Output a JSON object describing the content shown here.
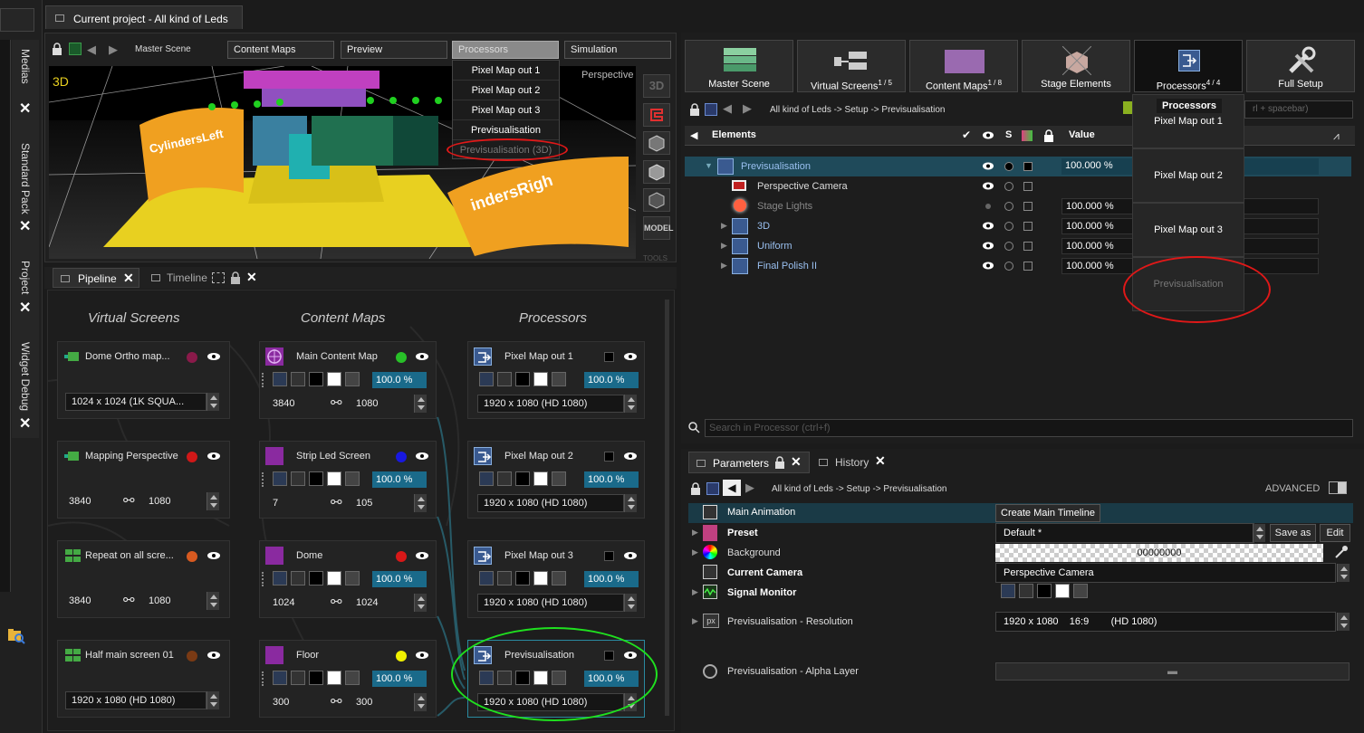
{
  "window": {
    "tab_title": "Current project - All kind of Leds"
  },
  "left_dock": {
    "tabs": [
      "Medias",
      "Standard Pack",
      "Project",
      "Widget Debug"
    ]
  },
  "viewport": {
    "breadcrumb_scene": "Master Scene",
    "crumbs": [
      "Content Maps",
      "Preview",
      "Processors",
      "Simulation"
    ],
    "processors_menu": [
      "Pixel Map out 1",
      "Pixel Map out 2",
      "Pixel Map out 3",
      "Previsualisation",
      "Previsualisation (3D)"
    ],
    "mode_label": "3D",
    "camera_label": "Perspective",
    "tools": [
      "3D",
      "magnet",
      "cube",
      "sphere",
      "cube2",
      "MODEL"
    ],
    "tools_footer": "TOOLS",
    "scene_text": [
      "CylindersLeft",
      "indersRigh"
    ]
  },
  "pipeline": {
    "tabs": [
      "Pipeline",
      "Timeline"
    ],
    "columns": [
      "Virtual Screens",
      "Content Maps",
      "Processors"
    ],
    "virtual_screens": [
      {
        "name": "Dome Ortho map...",
        "color": "#8a1a4a",
        "value": "1024 x 1024   (1K SQUA..."
      },
      {
        "name": "Mapping Perspective",
        "color": "#d01818",
        "a": "3840",
        "b": "1080"
      },
      {
        "name": "Repeat on all scre...",
        "color": "#d85a20",
        "a": "3840",
        "b": "1080"
      },
      {
        "name": "Half main screen 01",
        "color": "#7a3a14",
        "value": "1920 x 1080    (HD 1080)"
      }
    ],
    "content_maps": [
      {
        "name": "Main Content Map",
        "color": "#28c028",
        "pct": "100.0 %",
        "a": "3840",
        "b": "1080"
      },
      {
        "name": "Strip Led Screen",
        "color": "#1818e0",
        "pct": "100.0 %",
        "a": "7",
        "b": "105"
      },
      {
        "name": "Dome",
        "color": "#d81818",
        "pct": "100.0 %",
        "a": "1024",
        "b": "1024"
      },
      {
        "name": "Floor",
        "color": "#f0f000",
        "pct": "100.0 %",
        "a": "300",
        "b": "300"
      }
    ],
    "processors": [
      {
        "name": "Pixel Map out 1",
        "pct": "100.0 %",
        "value": "1920 x 1080    (HD 1080)"
      },
      {
        "name": "Pixel Map out 2",
        "pct": "100.0 %",
        "value": "1920 x 1080    (HD 1080)"
      },
      {
        "name": "Pixel Map out 3",
        "pct": "100.0 %",
        "value": "1920 x 1080    (HD 1080)"
      },
      {
        "name": "Previsualisation",
        "pct": "100.0 %",
        "value": "1920 x 1080    (HD 1080)"
      }
    ]
  },
  "top_tabs": [
    {
      "label": "Master Scene",
      "count": ""
    },
    {
      "label": "Virtual Screens",
      "count": "1 / 5"
    },
    {
      "label": "Content Maps",
      "count": "1 / 8"
    },
    {
      "label": "Stage Elements",
      "count": ""
    },
    {
      "label": "Processors",
      "count": "4 / 4"
    },
    {
      "label": "Full Setup",
      "count": ""
    }
  ],
  "elements_panel": {
    "path": "All kind of Leds -> Setup -> Previsualisation",
    "search_suffix": "rl + spacebar)",
    "headers": {
      "elements": "Elements",
      "s": "S",
      "value": "Value"
    },
    "rows": [
      {
        "name": "Previsualisation",
        "value": "100.000 %"
      },
      {
        "name": "Perspective Camera",
        "value": ""
      },
      {
        "name": "Stage Lights",
        "value": "100.000 %"
      },
      {
        "name": "3D",
        "value": "100.000 %"
      },
      {
        "name": "Uniform",
        "value": "100.000 %"
      },
      {
        "name": "Final Polish II",
        "value": "100.000 %"
      }
    ],
    "search_placeholder": "Search in Processor (ctrl+f)"
  },
  "processors_popup": {
    "title": "Processors",
    "items": [
      "Pixel Map out 1",
      "Pixel Map out 2",
      "Pixel Map out 3",
      "Previsualisation"
    ]
  },
  "parameters": {
    "tabs": [
      "Parameters",
      "History"
    ],
    "path": "All kind of Leds -> Setup -> Previsualisation",
    "advanced": "ADVANCED",
    "rows": [
      {
        "label": "Main Animation",
        "value": "Create Main Timeline"
      },
      {
        "label": "Preset",
        "value": "Default *"
      },
      {
        "label": "Background",
        "value": "00000000"
      },
      {
        "label": "Current Camera",
        "value": "Perspective Camera"
      },
      {
        "label": "Signal Monitor",
        "value": ""
      },
      {
        "label": "Previsualisation - Resolution",
        "value": "1920 x 1080    16:9        (HD 1080)"
      },
      {
        "label": "Previsualisation - Alpha Layer",
        "value": ""
      }
    ],
    "save_as": "Save as",
    "edit": "Edit"
  },
  "colors": {
    "accent": "#1a6a8a",
    "highlight_red": "#e01818",
    "highlight_green": "#1fe01f"
  }
}
